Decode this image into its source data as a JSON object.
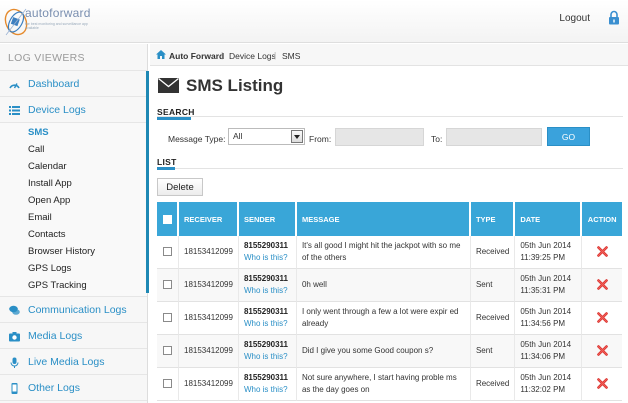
{
  "header": {
    "logo_text": "autoforward",
    "logo_tagline": "the best monitoring and surveillance app available",
    "logout_label": "Logout"
  },
  "sidebar": {
    "heading": "LOG VIEWERS",
    "dashboard": "Dashboard",
    "device_logs": "Device Logs",
    "sub_items": [
      "SMS",
      "Call",
      "Calendar",
      "Install App",
      "Open App",
      "Email",
      "Contacts",
      "Browser History",
      "GPS Logs",
      "GPS Tracking"
    ],
    "communication_logs": "Communication Logs",
    "media_logs": "Media Logs",
    "live_media_logs": "Live Media Logs",
    "other_logs": "Other Logs"
  },
  "breadcrumb": [
    "Auto Forward",
    "Device Logs",
    "SMS"
  ],
  "page": {
    "title": "SMS Listing"
  },
  "search": {
    "section_label": "SEARCH",
    "message_type_label": "Message Type:",
    "message_type_value": "All",
    "from_label": "From:",
    "from_value": "",
    "to_label": "To:",
    "to_value": "",
    "go_label": "GO"
  },
  "list": {
    "section_label": "LIST",
    "delete_label": "Delete",
    "columns": [
      "RECEIVER",
      "SENDER",
      "MESSAGE",
      "TYPE",
      "DATE",
      "ACTION"
    ],
    "rows": [
      {
        "receiver": "18153412099",
        "sender": "8155290311",
        "who": "Who is this?",
        "message": "It's all good I might hit the jackpot with so me of the others",
        "type": "Received",
        "date": "05th Jun 2014",
        "time": "11:39:25 PM"
      },
      {
        "receiver": "18153412099",
        "sender": "8155290311",
        "who": "Who is this?",
        "message": "0h well",
        "type": "Sent",
        "date": "05th Jun 2014",
        "time": "11:35:31 PM"
      },
      {
        "receiver": "18153412099",
        "sender": "8155290311",
        "who": "Who is this?",
        "message": "I only went through a few a lot were expir ed already",
        "type": "Received",
        "date": "05th Jun 2014",
        "time": "11:34:56 PM"
      },
      {
        "receiver": "18153412099",
        "sender": "8155290311",
        "who": "Who is this?",
        "message": "Did I give you some Good coupon s?",
        "type": "Sent",
        "date": "05th Jun 2014",
        "time": "11:34:06 PM"
      },
      {
        "receiver": "18153412099",
        "sender": "8155290311",
        "who": "Who is this?",
        "message": "Not sure anywhere, I start having proble ms as the day goes on",
        "type": "Received",
        "date": "05th Jun 2014",
        "time": "11:32:02 PM"
      }
    ]
  },
  "colors": {
    "accent": "#39a6d8",
    "link": "#2a8fc6",
    "delete_icon": "#d9302c"
  },
  "icons": {
    "logo": "satellite-logo-icon",
    "logout": "lock-icon",
    "dashboard": "dashboard-icon",
    "device_logs": "list-icon",
    "communication_logs": "chat-bubbles-icon",
    "media_logs": "camera-icon",
    "live_media_logs": "microphone-icon",
    "other_logs": "mobile-phone-icon",
    "breadcrumb_home": "home-icon",
    "title": "envelope-icon",
    "action": "delete-x-icon"
  }
}
